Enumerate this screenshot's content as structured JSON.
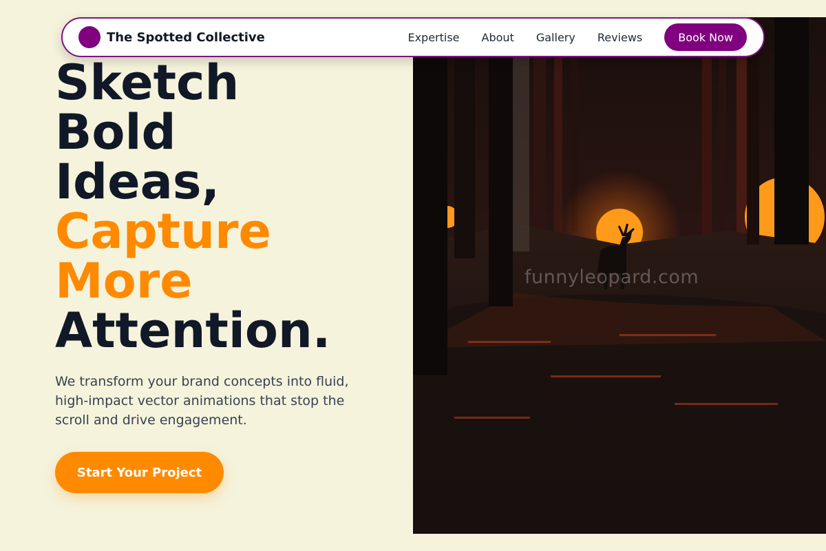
{
  "brand": {
    "name": "The Spotted Collective",
    "logo_color": "#800080"
  },
  "nav": {
    "links": [
      "Expertise",
      "About",
      "Gallery",
      "Reviews"
    ],
    "cta_label": "Book Now"
  },
  "hero": {
    "headline_lines": [
      "Sketch",
      "Bold",
      "Ideas,",
      "Capture",
      "More",
      "Attention."
    ],
    "description": "We transform your brand concepts into fluid, high-impact vector animations that stop the scroll and drive engagement.",
    "cta_label": "Start Your Project",
    "image": {
      "watermark": "funnyleopard.com"
    }
  },
  "colors": {
    "background": "#f5f3dc",
    "primary": "#800080",
    "accent": "#ff8a00",
    "text_dark": "#111827"
  }
}
